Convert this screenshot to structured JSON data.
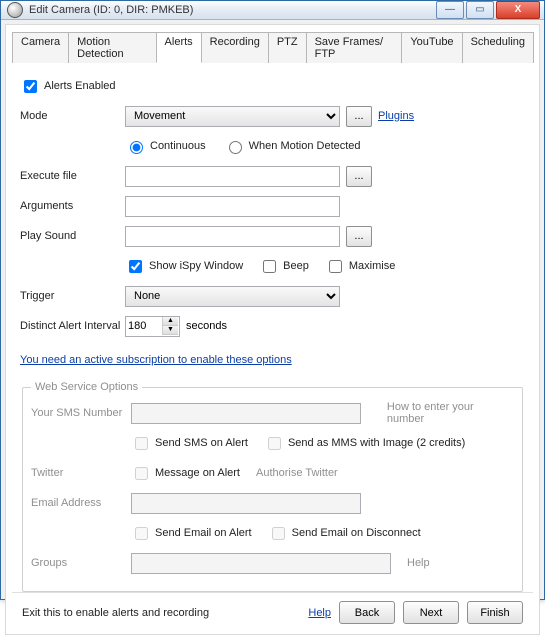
{
  "window": {
    "title": "Edit Camera (ID: 0, DIR: PMKEB)"
  },
  "tabs": [
    "Camera",
    "Motion Detection",
    "Alerts",
    "Recording",
    "PTZ",
    "Save Frames/ FTP",
    "YouTube",
    "Scheduling"
  ],
  "activeTab": "Alerts",
  "alerts": {
    "enabled_label": "Alerts Enabled",
    "enabled": true,
    "mode_label": "Mode",
    "mode_value": "Movement",
    "mode_browse": "...",
    "plugins_link": "Plugins",
    "radio_continuous": "Continuous",
    "radio_motion": "When Motion Detected",
    "continuous_selected": true,
    "execute_label": "Execute file",
    "execute_value": "",
    "execute_browse": "...",
    "arguments_label": "Arguments",
    "arguments_value": "",
    "playsound_label": "Play Sound",
    "playsound_value": "",
    "playsound_browse": "...",
    "chk_show_ispy": "Show iSpy Window",
    "chk_beep": "Beep",
    "chk_maximise": "Maximise",
    "show_ispy_checked": true,
    "trigger_label": "Trigger",
    "trigger_value": "None",
    "interval_label": "Distinct Alert Interval",
    "interval_value": "180",
    "interval_unit": "seconds",
    "subscription_notice": "You need an active subscription to enable these options"
  },
  "web": {
    "legend": "Web Service Options",
    "sms_label": "Your SMS Number",
    "sms_value": "",
    "sms_howto": "How to enter your number",
    "chk_send_sms": "Send SMS on Alert",
    "chk_send_mms": "Send as MMS with Image (2 credits)",
    "twitter_label": "Twitter",
    "chk_message_alert": "Message on Alert",
    "authorise_twitter": "Authorise Twitter",
    "email_label": "Email Address",
    "email_value": "",
    "chk_email_alert": "Send Email on Alert",
    "chk_email_disconnect": "Send Email on Disconnect",
    "groups_label": "Groups",
    "groups_value": "",
    "groups_help": "Help"
  },
  "footer": {
    "msg": "Exit this to enable alerts and recording",
    "help": "Help",
    "back": "Back",
    "next": "Next",
    "finish": "Finish"
  }
}
